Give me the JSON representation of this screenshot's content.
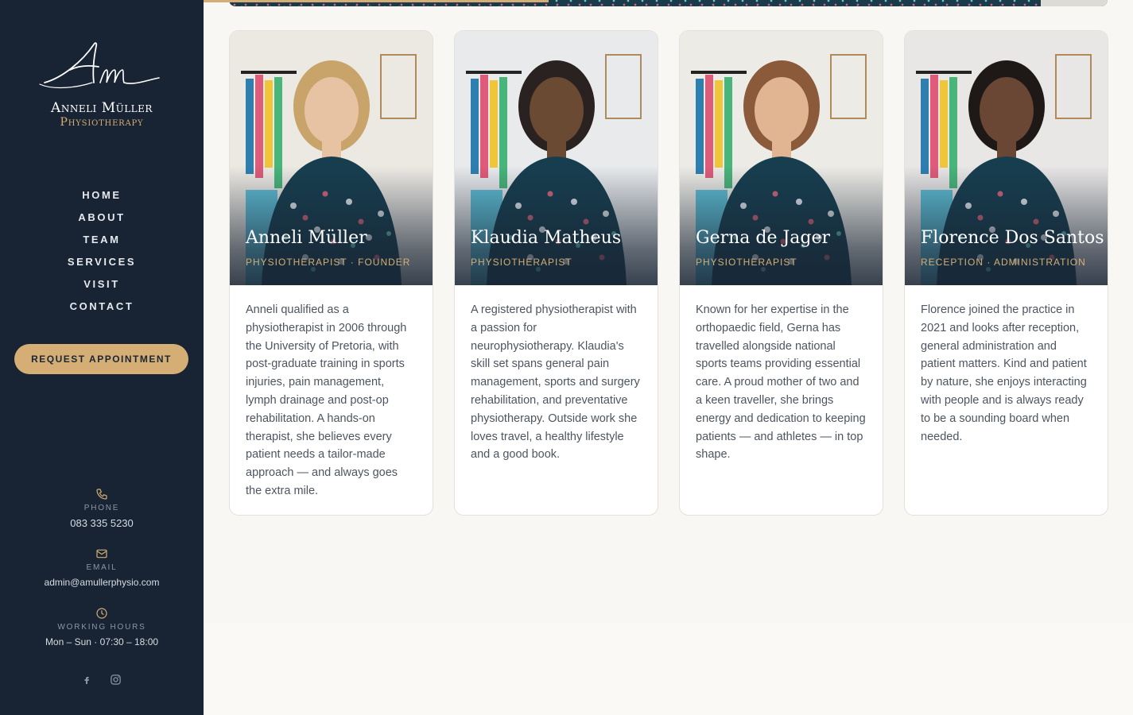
{
  "brand": {
    "monogram": "Am",
    "name": "Anneli Müller",
    "subtitle": "Physiotherapy"
  },
  "nav": {
    "items": [
      "HOME",
      "ABOUT",
      "TEAM",
      "SERVICES",
      "VISIT",
      "CONTACT"
    ]
  },
  "cta": {
    "label": "REQUEST APPOINTMENT"
  },
  "contact": {
    "phone_label": "PHONE",
    "phone": "083 335 5230",
    "email_label": "EMAIL",
    "email": "admin@amullerphysio.com",
    "hours_label": "WORKING HOURS",
    "hours": "Mon – Sun · 07:30 – 18:00"
  },
  "colors": {
    "sidebar": "#182433",
    "accent": "#d4ae75",
    "page_bg": "#f8f7f3"
  },
  "team": [
    {
      "name": "Anneli Müller",
      "role": "PHYSIOTHERAPIST · FOUNDER",
      "bio": "Anneli qualified as a physiotherapist in 2006 through the University of Pretoria, with post-graduate training in sports injuries, pain management, lymph drainage and post-op rehabilitation. A hands-on therapist, she believes every patient needs a tailor-made approach — and always goes the extra mile."
    },
    {
      "name": "Klaudia Matheus",
      "role": "PHYSIOTHERAPIST",
      "bio": "A registered physiotherapist with a passion for neurophysiotherapy. Klaudia's skill set spans general pain management, sports and surgery rehabilitation, and preventative physiotherapy. Outside work she loves travel, a healthy lifestyle and a good book."
    },
    {
      "name": "Gerna de Jager",
      "role": "PHYSIOTHERAPIST",
      "bio": "Known for her expertise in the orthopaedic field, Gerna has travelled alongside national sports teams providing essential care. A proud mother of two and a keen traveller, she brings energy and dedication to keeping patients — and athletes — in top shape."
    },
    {
      "name": "Florence Dos Santos",
      "role": "RECEPTION · ADMINISTRATION",
      "bio": "Florence joined the practice in 2021 and looks after reception, general administration and patient matters. Kind and patient by nature, she enjoys interacting with people and is always ready to be a sounding board when needed."
    }
  ]
}
